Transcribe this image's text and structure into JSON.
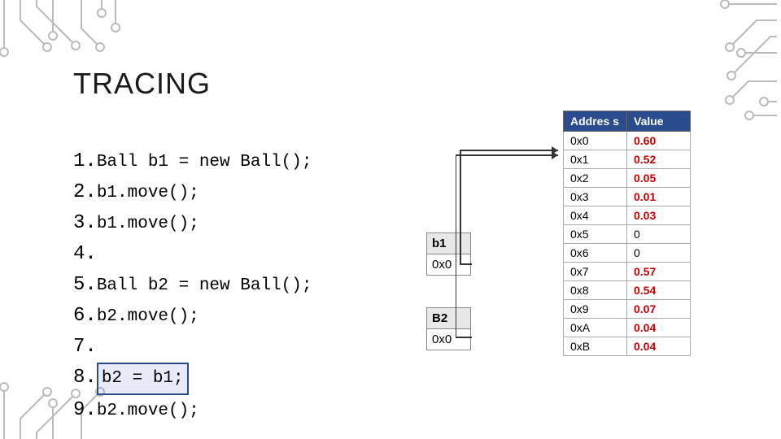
{
  "title": "TRACING",
  "code": [
    {
      "n": "1.",
      "t": "Ball b1 = new Ball();"
    },
    {
      "n": "2.",
      "t": "b1.move();"
    },
    {
      "n": "3.",
      "t": "b1.move();"
    },
    {
      "n": "4.",
      "t": ""
    },
    {
      "n": "5.",
      "t": "Ball b2 = new Ball();"
    },
    {
      "n": "6.",
      "t": "b2.move();"
    },
    {
      "n": "7.",
      "t": ""
    },
    {
      "n": "8.",
      "t": "b2 = b1;"
    },
    {
      "n": "9.",
      "t": "b2.move();"
    }
  ],
  "highlight_index": 7,
  "var1": {
    "name": "b1",
    "val": "0x0"
  },
  "var2": {
    "name": "B2",
    "val": "0x0"
  },
  "mem": {
    "head": {
      "a": "Addres s",
      "v": "Value"
    },
    "rows": [
      {
        "a": "0x0",
        "v": "0.60",
        "red": true
      },
      {
        "a": "0x1",
        "v": "0.52",
        "red": true
      },
      {
        "a": "0x2",
        "v": "0.05",
        "red": true
      },
      {
        "a": "0x3",
        "v": "0.01",
        "red": true
      },
      {
        "a": "0x4",
        "v": "0.03",
        "red": true
      },
      {
        "a": "0x5",
        "v": "0",
        "red": false
      },
      {
        "a": "0x6",
        "v": "0",
        "red": false
      },
      {
        "a": "0x7",
        "v": "0.57",
        "red": true
      },
      {
        "a": "0x8",
        "v": "0.54",
        "red": true
      },
      {
        "a": "0x9",
        "v": "0.07",
        "red": true
      },
      {
        "a": "0xA",
        "v": "0.04",
        "red": true
      },
      {
        "a": "0xB",
        "v": "0.04",
        "red": true
      }
    ]
  }
}
